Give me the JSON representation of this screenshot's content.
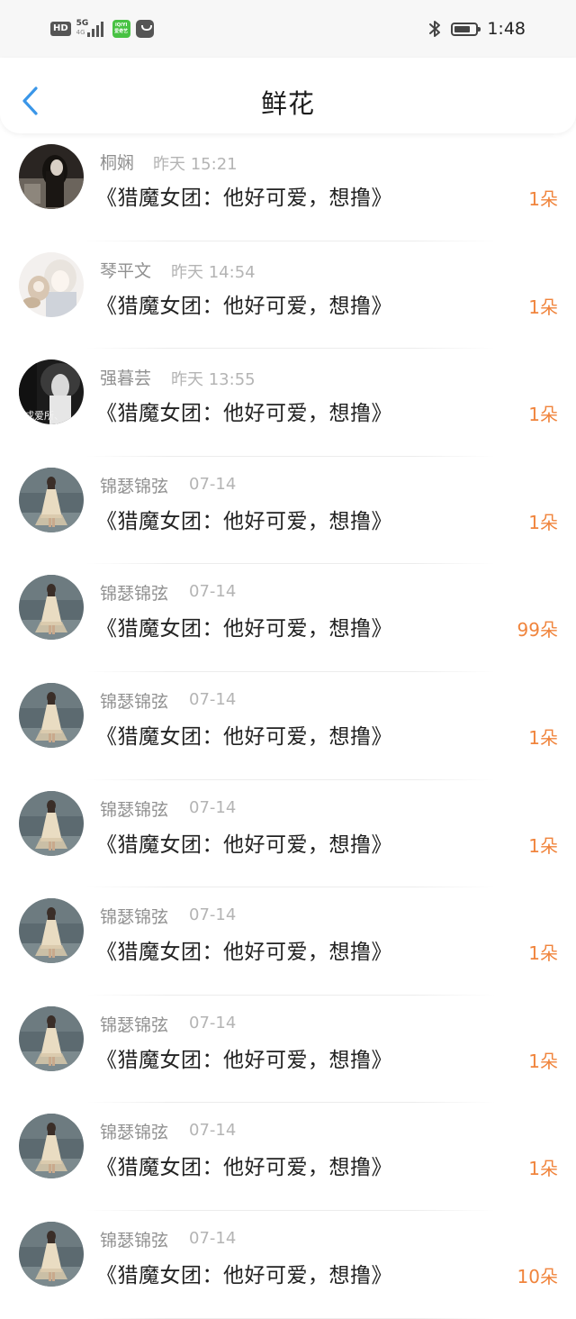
{
  "status_bar": {
    "hd": "HD",
    "network": "5G",
    "network_sub": "4G",
    "app_badge_line1": "iQIYI",
    "app_badge_line2": "爱奇艺",
    "time": "1:48"
  },
  "header": {
    "title": "鲜花"
  },
  "rows": [
    {
      "name": "桐娴",
      "time": "昨天 15:21",
      "message": "《猎魔女团：他好可爱，想撸》",
      "count": "1朵",
      "avatar": "dark"
    },
    {
      "name": "琴平文",
      "time": "昨天 14:54",
      "message": "《猎魔女团：他好可爱，想撸》",
      "count": "1朵",
      "avatar": "anime"
    },
    {
      "name": "强暮芸",
      "time": "昨天 13:55",
      "message": "《猎魔女团：他好可爱，想撸》",
      "count": "1朵",
      "avatar": "bw",
      "avatar_text": "成爱所、"
    },
    {
      "name": "锦瑟锦弦",
      "time": "07-14",
      "message": "《猎魔女团：他好可爱，想撸》",
      "count": "1朵",
      "avatar": "sea"
    },
    {
      "name": "锦瑟锦弦",
      "time": "07-14",
      "message": "《猎魔女团：他好可爱，想撸》",
      "count": "99朵",
      "avatar": "sea"
    },
    {
      "name": "锦瑟锦弦",
      "time": "07-14",
      "message": "《猎魔女团：他好可爱，想撸》",
      "count": "1朵",
      "avatar": "sea"
    },
    {
      "name": "锦瑟锦弦",
      "time": "07-14",
      "message": "《猎魔女团：他好可爱，想撸》",
      "count": "1朵",
      "avatar": "sea"
    },
    {
      "name": "锦瑟锦弦",
      "time": "07-14",
      "message": "《猎魔女团：他好可爱，想撸》",
      "count": "1朵",
      "avatar": "sea"
    },
    {
      "name": "锦瑟锦弦",
      "time": "07-14",
      "message": "《猎魔女团：他好可爱，想撸》",
      "count": "1朵",
      "avatar": "sea"
    },
    {
      "name": "锦瑟锦弦",
      "time": "07-14",
      "message": "《猎魔女团：他好可爱，想撸》",
      "count": "1朵",
      "avatar": "sea"
    },
    {
      "name": "锦瑟锦弦",
      "time": "07-14",
      "message": "《猎魔女团：他好可爱，想撸》",
      "count": "10朵",
      "avatar": "sea"
    }
  ],
  "colors": {
    "accent_blue": "#3a96e8",
    "count_orange": "#f0843c"
  }
}
